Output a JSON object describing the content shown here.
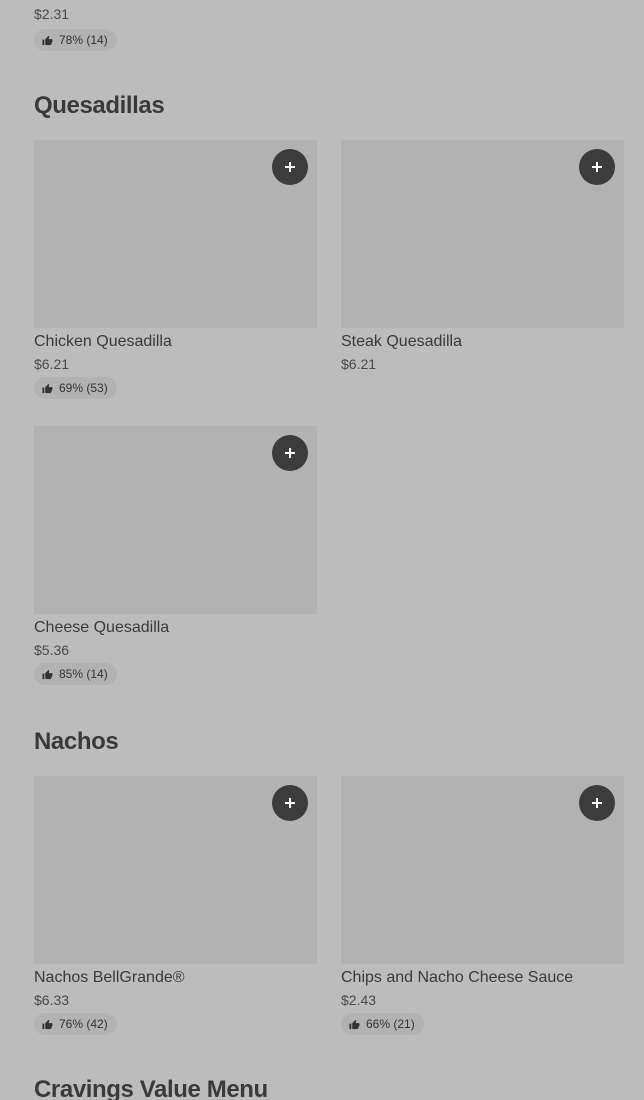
{
  "top_item": {
    "price": "$2.31",
    "rating": "78% (14)"
  },
  "sections": [
    {
      "title": "Quesadillas",
      "items": [
        {
          "name": "Chicken Quesadilla",
          "price": "$6.21",
          "rating": "69% (53)"
        },
        {
          "name": "Steak Quesadilla",
          "price": "$6.21",
          "rating": ""
        },
        {
          "name": "Cheese Quesadilla",
          "price": "$5.36",
          "rating": "85% (14)"
        }
      ]
    },
    {
      "title": "Nachos",
      "items": [
        {
          "name": "Nachos BellGrande®",
          "price": "$6.33",
          "rating": "76% (42)"
        },
        {
          "name": "Chips and Nacho Cheese Sauce",
          "price": "$2.43",
          "rating": "66% (21)"
        }
      ]
    },
    {
      "title": "Cravings Value Menu",
      "items": []
    }
  ],
  "icons": {
    "add": "plus-icon",
    "rating": "thumbs-up-icon"
  },
  "colors": {
    "background": "#bcbcbc",
    "card_image": "#b2b2b2",
    "add_button": "#3c3c3c",
    "text": "#3a3a3a"
  }
}
